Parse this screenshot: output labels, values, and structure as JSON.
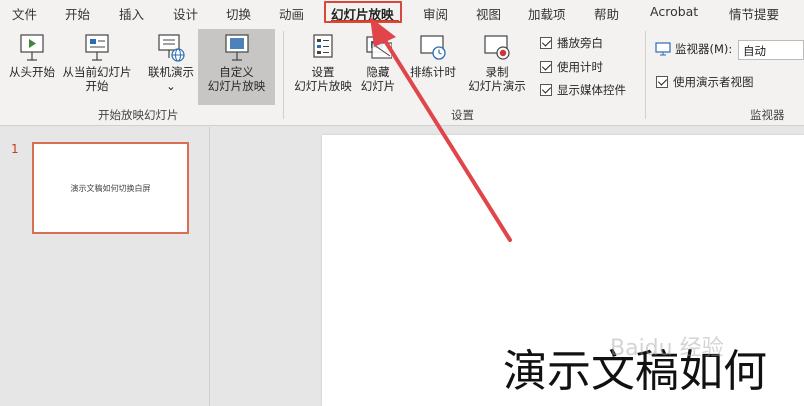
{
  "tabs": [
    {
      "label": "文件"
    },
    {
      "label": "开始"
    },
    {
      "label": "插入"
    },
    {
      "label": "设计"
    },
    {
      "label": "切换"
    },
    {
      "label": "动画"
    },
    {
      "label": "幻灯片放映"
    },
    {
      "label": "审阅"
    },
    {
      "label": "视图"
    },
    {
      "label": "加载项"
    },
    {
      "label": "帮助"
    },
    {
      "label": "Acrobat"
    },
    {
      "label": "情节提要"
    }
  ],
  "ribbon": {
    "start_group": {
      "label": "开始放映幻灯片",
      "from_beginning": "从头开始",
      "from_current_1": "从当前幻灯片",
      "from_current_2": "开始",
      "online_present": "联机演示",
      "custom_1": "自定义",
      "custom_2": "幻灯片放映"
    },
    "setup_group": {
      "label": "设置",
      "setup_1": "设置",
      "setup_2": "幻灯片放映",
      "hide_1": "隐藏",
      "hide_2": "幻灯片",
      "rehearse": "排练计时",
      "record_1": "录制",
      "record_2": "幻灯片演示",
      "chk_narration": "播放旁白",
      "chk_timing": "使用计时",
      "chk_media": "显示媒体控件"
    },
    "monitor_group": {
      "label": "监视器",
      "monitor_label": "监视器(M):",
      "monitor_value": "自动",
      "presenter_view": "使用演示者视图"
    }
  },
  "thumbnails": [
    {
      "number": "1",
      "text": "演示文稿如何切换白屏"
    }
  ],
  "slide": {
    "title": "演示文稿如何"
  },
  "watermark": "Baidu 经验",
  "colors": {
    "accent": "#c43e1c",
    "annotation": "#e0454a",
    "ribbon_bg": "#f3f2f1"
  }
}
